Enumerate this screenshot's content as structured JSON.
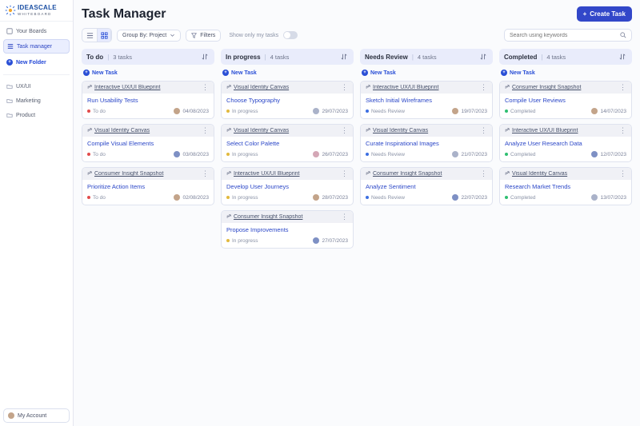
{
  "brand": {
    "name": "IDEASCALE",
    "sub": "WHITEBOARD"
  },
  "sidebar": {
    "items": [
      {
        "label": "Your Boards",
        "active": false
      },
      {
        "label": "Task manager",
        "active": true
      }
    ],
    "new_folder": "New Folder",
    "folders": [
      "UX/UI",
      "Marketing",
      "Product"
    ],
    "account": "My Account"
  },
  "header": {
    "title": "Task Manager",
    "create_btn": "Create Task"
  },
  "toolbar": {
    "group_by": "Group By: Project",
    "filters": "Filters",
    "show_only": "Show only my tasks",
    "search_placeholder": "Search using keywords"
  },
  "columns": [
    {
      "title": "To do",
      "count": "3 tasks",
      "new_task": "New Task",
      "status_label": "To do",
      "status_color": "red",
      "cards": [
        {
          "project": "Interactive UX/UI Blueprint",
          "title": "Run Usability Tests",
          "date": "04/08/2023",
          "avatar": "a"
        },
        {
          "project": "Visual Identity Canvas",
          "title": "Compile Visual Elements",
          "date": "03/08/2023",
          "avatar": "b"
        },
        {
          "project": "Consumer Insight Snapshot",
          "title": "Prioritize Action Items",
          "date": "02/08/2023",
          "avatar": "a"
        }
      ]
    },
    {
      "title": "In progress",
      "count": "4 tasks",
      "new_task": "New Task",
      "status_label": "In progress",
      "status_color": "yellow",
      "cards": [
        {
          "project": "Visual Identity Canvas",
          "title": "Choose Typography",
          "date": "29/07/2023",
          "avatar": "c"
        },
        {
          "project": "Visual Identity Canvas",
          "title": "Select Color Palette",
          "date": "26/07/2023",
          "avatar": "d"
        },
        {
          "project": "Interactive UX/UI Blueprint",
          "title": "Develop User Journeys",
          "date": "28/07/2023",
          "avatar": "a"
        },
        {
          "project": "Consumer Insight Snapshot",
          "title": "Propose Improvements",
          "date": "27/07/2023",
          "avatar": "b"
        }
      ]
    },
    {
      "title": "Needs Review",
      "count": "4 tasks",
      "new_task": "New Task",
      "status_label": "Needs Review",
      "status_color": "blue",
      "cards": [
        {
          "project": "Interactive UX/UI Blueprint",
          "title": "Sketch Initial Wireframes",
          "date": "19/07/2023",
          "avatar": "a"
        },
        {
          "project": "Visual Identity Canvas",
          "title": "Curate Inspirational Images",
          "date": "21/07/2023",
          "avatar": "c"
        },
        {
          "project": "Consumer Insight Snapshot",
          "title": "Analyze Sentiment",
          "date": "22/07/2023",
          "avatar": "b"
        }
      ]
    },
    {
      "title": "Completed",
      "count": "4 tasks",
      "new_task": "New Task",
      "status_label": "Completed",
      "status_color": "green",
      "cards": [
        {
          "project": "Consumer Insight Snapshot",
          "title": "Compile User Reviews",
          "date": "14/07/2023",
          "avatar": "a"
        },
        {
          "project": "Interactive UX/UI Blueprint",
          "title": "Analyze User Research Data",
          "date": "12/07/2023",
          "avatar": "b"
        },
        {
          "project": "Visual Identity Canvas",
          "title": "Research Market Trends",
          "date": "13/07/2023",
          "avatar": "c"
        }
      ]
    }
  ]
}
